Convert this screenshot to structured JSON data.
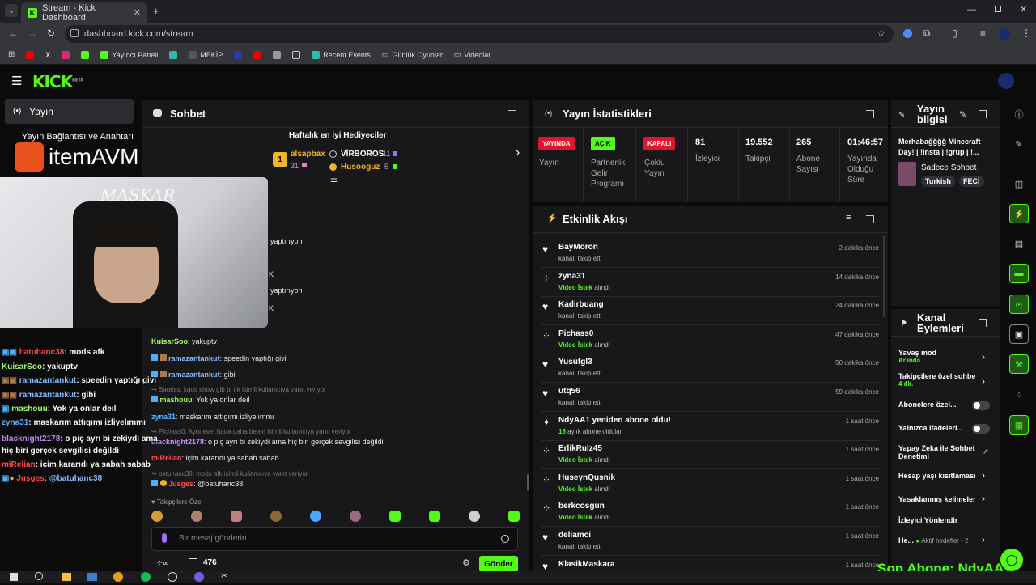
{
  "browser": {
    "tab_title": "Stream - Kick Dashboard",
    "url": "dashboard.kick.com/stream",
    "bookmarks": [
      "Yayıncı Paneli",
      "MEKİP",
      "Recent Events",
      "Günlük Oyunlar",
      "Videolar"
    ]
  },
  "kick": {
    "logo": "KICK",
    "beta": "BETA"
  },
  "left_nav": {
    "active": "Yayın",
    "item2": "Yayın Bağlantısı ve Anahtarı"
  },
  "overlay": {
    "brand": "itemAVM",
    "cam_name": "MASKAR",
    "chat": [
      {
        "user": "batuhanc38",
        "text": ": mods afk",
        "color": "#ff4d4d"
      },
      {
        "user": "KuisarSoo",
        "text": ": yakuptv",
        "color": "#9fff5a"
      },
      {
        "user": "ramazantankut",
        "text": ": speedin yaptığı givi",
        "color": "#88c0ff"
      },
      {
        "user": "ramazantankut",
        "text": ": gibi",
        "color": "#88c0ff"
      },
      {
        "user": "mashouu",
        "text": ": Yok ya onlar deıl",
        "color": "#9fff5a"
      },
      {
        "user": "zyna31",
        "text": ": maskarım attıgımı izliyelımmı",
        "color": "#5ab4ff"
      },
      {
        "user": "blacknight2178",
        "text": ": o piç ayrı bi zekiydi ama hiç biri gerçek sevgilisi değildi",
        "color": "#c98bff"
      },
      {
        "user": "miRelian",
        "text": ": içim kararıdı ya sabah sabab",
        "color": "#ff4d4d"
      },
      {
        "user": "Jusges",
        "text": ": @batuhanc38",
        "color": "#ff4d4d"
      }
    ],
    "sub_ticker": "Son Abone: NdyAA1"
  },
  "chat_panel": {
    "title": "Sohbet",
    "gifters_title": "Haftalık en iyi Hediyeciler",
    "gifters": [
      {
        "name": "alsapbax",
        "count": "31",
        "color": "#f0b429"
      },
      {
        "name": "VİRBOROS",
        "count": "11",
        "color": "#ffffff"
      },
      {
        "name": "Husooguz",
        "count": "5",
        "color": "#f0b429"
      }
    ],
    "rank": "1",
    "partial1": "yaptırıyon",
    "partial2": "K",
    "partial3": "yaptırıyon",
    "partial4": "K",
    "messages": [
      {
        "user": "KuisarSoo",
        "text": ": yakuptv",
        "color": "#9fff5a"
      },
      {
        "user": "ramazantankut",
        "text": ": speedin yaptığı givi",
        "color": "#88c0ff"
      },
      {
        "user": "ramazantankut",
        "text": ": gibi",
        "color": "#88c0ff"
      }
    ],
    "reply1": "Saoriss: kaos show gib bi tık isimli kullanıcıya yanıt veriyor",
    "msg_mashouu": {
      "user": "mashouu",
      "text": ": Yok ya onlar deıl"
    },
    "msg_zyna": {
      "user": "zyna31",
      "text": ": maskarım attıgımı izliyelımmı"
    },
    "reply2": "Pichass0: Aynı evet hatta daha beteri isimli kullanıcıya yanıt veriyor",
    "msg_black": {
      "user": "blacknight2178",
      "text": ": o piç ayrı bi zekiydi ama hiç biri gerçek sevgilisi değildi"
    },
    "msg_mirelian": {
      "user": "miRelian",
      "text": ": içim kararıdı ya sabah sabab"
    },
    "reply3": "batuhanc38: mods afk isimli kullanıcıya yanıt veriyor",
    "msg_jusges": {
      "user": "Jusges",
      "text": "@batuhanc38"
    },
    "followers_only": "Takipçilere Özel",
    "input_placeholder": "Bir mesaj gönderin",
    "points": "476",
    "send": "Gönder"
  },
  "stats": {
    "title": "Yayın İstatistikleri",
    "items": [
      {
        "badge": "YAYINDA",
        "label": "Yayın",
        "badge_color": "#e0142b"
      },
      {
        "badge": "AÇIK",
        "label": "Partnerlik Gelir Programı",
        "badge_color": "#53fc18"
      },
      {
        "badge": "KAPALI",
        "label": "Çoklu Yayın",
        "badge_color": "#e0142b"
      },
      {
        "value": "81",
        "label": "İzleyici"
      },
      {
        "value": "19.552",
        "label": "Takipçi"
      },
      {
        "value": "265",
        "label": "Abone Sayısı"
      },
      {
        "value": "01:46:57",
        "label": "Yayında Olduğu Süre"
      }
    ]
  },
  "activity": {
    "title": "Etkinlik Akışı",
    "items": [
      {
        "name": "BayMoron",
        "sub": "kanalı takip etti",
        "time": "2 dakika önce",
        "icon": "heart-icon"
      },
      {
        "name": "zyna31",
        "hl": "Video İstek",
        "sub": " alındı",
        "time": "14 dakika önce",
        "icon": "dots-icon"
      },
      {
        "name": "Kadirbuang",
        "sub": "kanalı takip etti",
        "time": "24 dakika önce",
        "icon": "heart-icon"
      },
      {
        "name": "Pichass0",
        "hl": "Video İstek",
        "sub": " alındı",
        "time": "47 dakika önce",
        "icon": "dots-icon"
      },
      {
        "name": "Yusufgl3",
        "sub": "kanalı takip etti",
        "time": "50 dakika önce",
        "icon": "heart-icon"
      },
      {
        "name": "utq56",
        "sub": "kanalı takip etti",
        "time": "59 dakika önce",
        "icon": "heart-icon"
      },
      {
        "name": "NdyAA1 yeniden abone oldu!",
        "hl": "18",
        "sub": " aylık abone oldular",
        "time": "1 saat önce",
        "icon": "star-icon"
      },
      {
        "name": "ErlikRulz45",
        "hl": "Video İstek",
        "sub": " alındı",
        "time": "1 saat önce",
        "icon": "dots-icon"
      },
      {
        "name": "HuseynQusnik",
        "hl": "Video İstek",
        "sub": " alındı",
        "time": "1 saat önce",
        "icon": "dots-icon"
      },
      {
        "name": "berkcosgun",
        "hl": "Video İstek",
        "sub": " alındı",
        "time": "1 saat önce",
        "icon": "dots-icon"
      },
      {
        "name": "deliamci",
        "sub": "kanalı takip etti",
        "time": "1 saat önce",
        "icon": "heart-icon"
      },
      {
        "name": "KlasikMaskara",
        "sub": "",
        "time": "1 saat önce",
        "icon": "heart-icon"
      }
    ]
  },
  "stream_info": {
    "title": "Yayın bilgisi",
    "stream_title": "Merhabağğğğ Minecraft Day! | !insta | !grup | !...",
    "category": "Sadece Sohbet",
    "tags": [
      "Turkish",
      "FECİ"
    ]
  },
  "channel_actions": {
    "title": "Kanal Eylemleri",
    "items": [
      {
        "label": "Yavaş mod",
        "sub": "Anında",
        "type": "chevron"
      },
      {
        "label": "Takipçilere özel sohbe",
        "sub": "4 dk.",
        "type": "chevron"
      },
      {
        "label": "Abonelere özel...",
        "type": "toggle"
      },
      {
        "label": "Yalnızca ifadeleri...",
        "type": "toggle"
      },
      {
        "label": "Yapay Zeka ile Sohbet Denetimi",
        "type": "external"
      },
      {
        "label": "Hesap yaşı kısıtlaması",
        "type": "chevron"
      },
      {
        "label": "Yasaklanmış kelimeler",
        "type": "chevron"
      },
      {
        "label": "İzleyici Yönlendir",
        "type": "none"
      },
      {
        "label": "He...",
        "sub": "Aktif hedefler - 2",
        "type": "chevron"
      }
    ]
  },
  "colors": {
    "accent": "#53fc18",
    "panel": "#18181b",
    "bg": "#0b0b0c"
  }
}
